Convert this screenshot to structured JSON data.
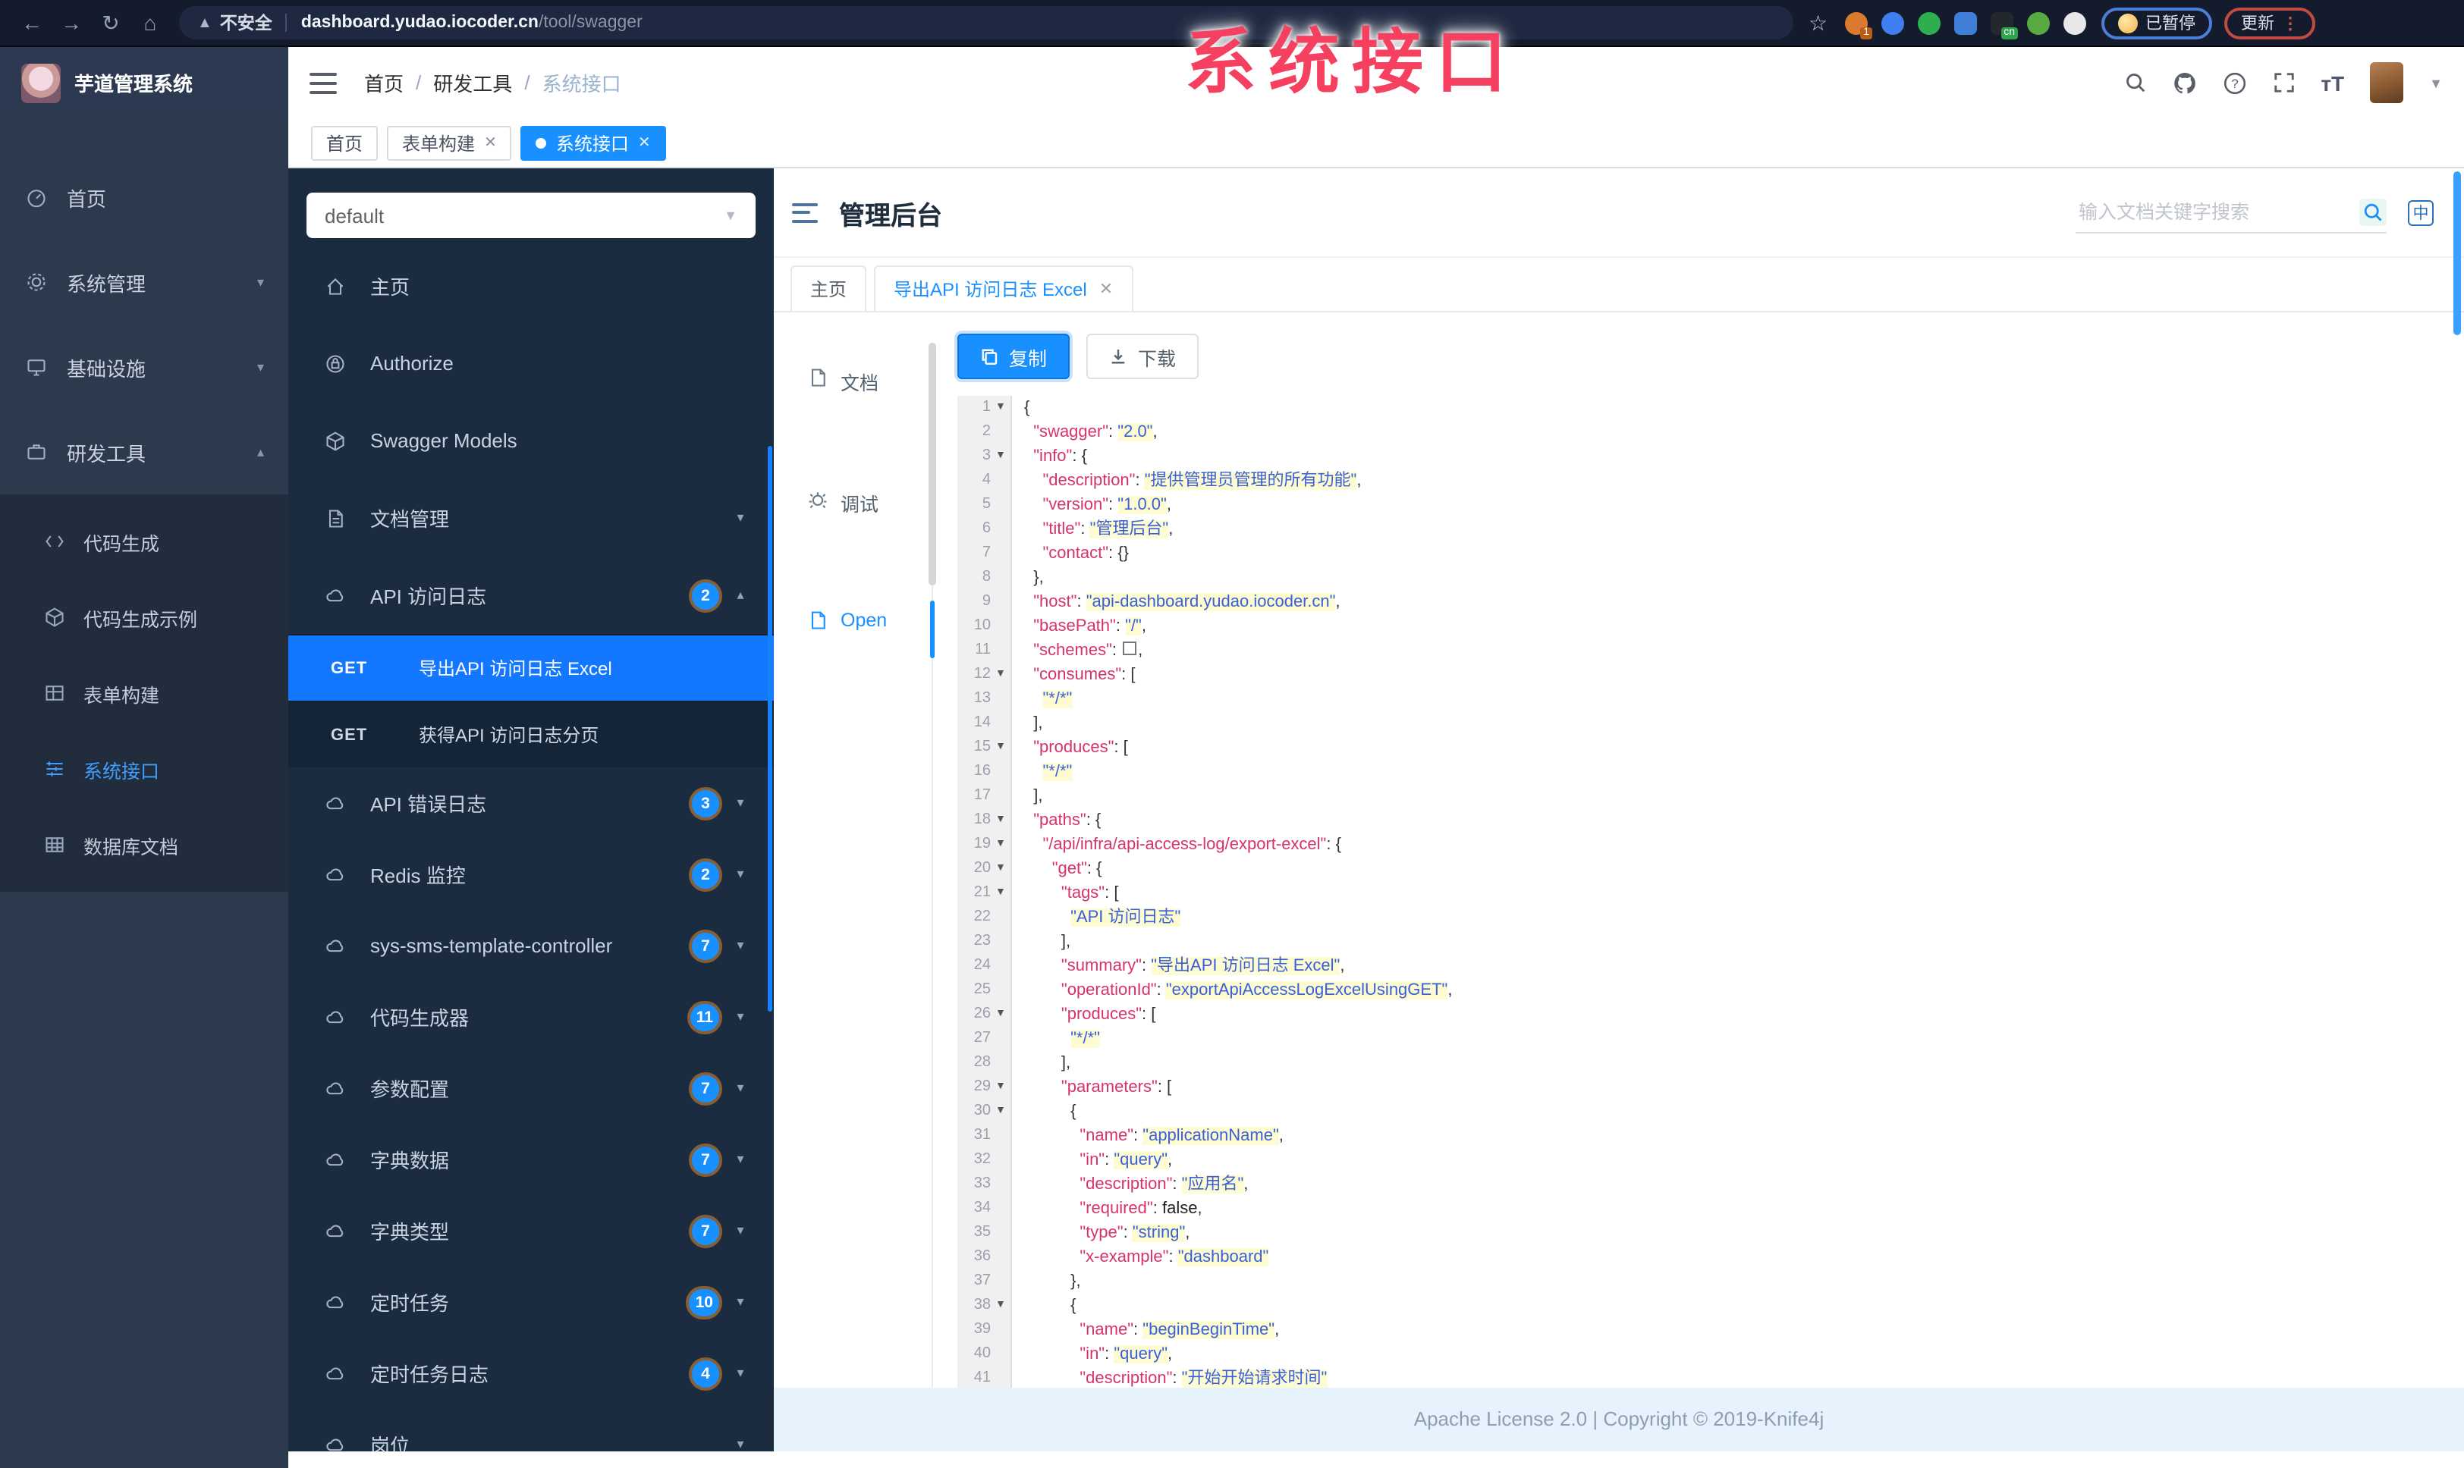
{
  "browser": {
    "security_label": "不安全",
    "url_host": "dashboard.yudao.iocoder.cn",
    "url_path": "/tool/swagger",
    "nav_icons": [
      "back-arrow",
      "forward-arrow",
      "reload",
      "home"
    ],
    "extensions": [
      {
        "name": "bookmark-star",
        "shape": "star"
      },
      {
        "name": "ext-orange",
        "shape": "round",
        "color": "#d97a2e",
        "badge": "1",
        "badge_color": "#b85c1a"
      },
      {
        "name": "ext-blue-drop",
        "shape": "round",
        "color": "#3d7ff0"
      },
      {
        "name": "ext-green-circle",
        "shape": "round",
        "color": "#2fae4e"
      },
      {
        "name": "ext-blue-grid",
        "shape": "square",
        "color": "#3f7fd9"
      },
      {
        "name": "ext-dark-cn",
        "shape": "square",
        "color": "#23282e",
        "badge": "cn",
        "badge_color": "#2da44e"
      },
      {
        "name": "ext-green-leaf",
        "shape": "round",
        "color": "#58a942"
      },
      {
        "name": "ext-white-ghost",
        "shape": "round",
        "color": "#e8e8ea"
      }
    ],
    "paused_label": "已暂停",
    "update_label": "更新",
    "update_menu_glyph": "⋮"
  },
  "overlay": {
    "text": "系统接口",
    "color": "#f5405f"
  },
  "app_header": {
    "logo_text": "芋道管理系统",
    "breadcrumb": [
      "首页",
      "研发工具",
      "系统接口"
    ],
    "right_icons": [
      "search-icon",
      "github-icon",
      "help-icon",
      "fullscreen-icon",
      "font-size-icon",
      "avatar",
      "dropdown-caret"
    ]
  },
  "page_tabs": [
    {
      "label": "首页",
      "closable": false,
      "active": false
    },
    {
      "label": "表单构建",
      "closable": true,
      "active": false
    },
    {
      "label": "系统接口",
      "closable": true,
      "active": true
    }
  ],
  "sidebar": {
    "items": [
      {
        "icon": "dashboard",
        "label": "首页",
        "chevron": ""
      },
      {
        "icon": "gear",
        "label": "系统管理",
        "chevron": "down"
      },
      {
        "icon": "infra",
        "label": "基础设施",
        "chevron": "down"
      },
      {
        "icon": "tools",
        "label": "研发工具",
        "chevron": "up"
      }
    ],
    "subitems": [
      {
        "icon": "code",
        "label": "代码生成",
        "active": false
      },
      {
        "icon": "cube",
        "label": "代码生成示例",
        "active": false
      },
      {
        "icon": "grid",
        "label": "表单构建",
        "active": false
      },
      {
        "icon": "apilist",
        "label": "系统接口",
        "active": true
      },
      {
        "icon": "table",
        "label": "数据库文档",
        "active": false
      }
    ]
  },
  "api_nav": {
    "group_select_value": "default",
    "items": [
      {
        "icon": "home",
        "label": "主页",
        "badge": "",
        "chevron": ""
      },
      {
        "icon": "lock",
        "label": "Authorize",
        "badge": "",
        "chevron": ""
      },
      {
        "icon": "cube",
        "label": "Swagger Models",
        "badge": "",
        "chevron": ""
      },
      {
        "icon": "doc",
        "label": "文档管理",
        "badge": "",
        "chevron": "down"
      },
      {
        "icon": "cloud",
        "label": "API 访问日志",
        "badge": "2",
        "chevron": "up"
      }
    ],
    "endpoints": [
      {
        "method": "GET",
        "label": "导出API 访问日志 Excel",
        "active": true
      },
      {
        "method": "GET",
        "label": "获得API 访问日志分页",
        "active": false
      }
    ],
    "groups": [
      {
        "icon": "cloud",
        "label": "API 错误日志",
        "badge": "3"
      },
      {
        "icon": "cloud",
        "label": "Redis 监控",
        "badge": "2"
      },
      {
        "icon": "cloud",
        "label": "sys-sms-template-controller",
        "badge": "7"
      },
      {
        "icon": "cloud",
        "label": "代码生成器",
        "badge": "11"
      },
      {
        "icon": "cloud",
        "label": "参数配置",
        "badge": "7"
      },
      {
        "icon": "cloud",
        "label": "字典数据",
        "badge": "7"
      },
      {
        "icon": "cloud",
        "label": "字典类型",
        "badge": "7"
      },
      {
        "icon": "cloud",
        "label": "定时任务",
        "badge": "10"
      },
      {
        "icon": "cloud",
        "label": "定时任务日志",
        "badge": "4"
      },
      {
        "icon": "cloud",
        "label": "岗位",
        "badge": ""
      }
    ]
  },
  "content": {
    "title": "管理后台",
    "search_placeholder": "输入文档关键字搜索",
    "lang_glyph": "中",
    "doc_tabs": [
      {
        "label": "主页",
        "closable": false,
        "active": false
      },
      {
        "label": "导出API 访问日志 Excel",
        "closable": true,
        "active": true
      }
    ],
    "rail": [
      {
        "icon": "file",
        "label": "文档",
        "active": false
      },
      {
        "icon": "debug",
        "label": "调试",
        "active": false
      },
      {
        "icon": "file",
        "label": "Open",
        "active": true
      }
    ],
    "copy_label": "复制",
    "download_label": "下载",
    "footer": "Apache License 2.0 | Copyright © 2019-Knife4j"
  },
  "code": {
    "lines": [
      [
        1,
        [
          [
            "p",
            "{"
          ]
        ]
      ],
      [
        0,
        [
          [
            "p",
            "  "
          ],
          [
            "k",
            "\"swagger\""
          ],
          [
            "p",
            ": "
          ],
          [
            "s",
            "\"2.0\""
          ],
          [
            "p",
            ","
          ]
        ]
      ],
      [
        1,
        [
          [
            "p",
            "  "
          ],
          [
            "k",
            "\"info\""
          ],
          [
            "p",
            ": {"
          ]
        ]
      ],
      [
        0,
        [
          [
            "p",
            "    "
          ],
          [
            "k",
            "\"description\""
          ],
          [
            "p",
            ": "
          ],
          [
            "s",
            "\"提供管理员管理的所有功能\""
          ],
          [
            "p",
            ","
          ]
        ]
      ],
      [
        0,
        [
          [
            "p",
            "    "
          ],
          [
            "k",
            "\"version\""
          ],
          [
            "p",
            ": "
          ],
          [
            "s",
            "\"1.0.0\""
          ],
          [
            "p",
            ","
          ]
        ]
      ],
      [
        0,
        [
          [
            "p",
            "    "
          ],
          [
            "k",
            "\"title\""
          ],
          [
            "p",
            ": "
          ],
          [
            "s",
            "\"管理后台\""
          ],
          [
            "p",
            ","
          ]
        ]
      ],
      [
        0,
        [
          [
            "p",
            "    "
          ],
          [
            "k",
            "\"contact\""
          ],
          [
            "p",
            ": {}"
          ]
        ]
      ],
      [
        0,
        [
          [
            "p",
            "  },"
          ]
        ]
      ],
      [
        0,
        [
          [
            "p",
            "  "
          ],
          [
            "k",
            "\"host\""
          ],
          [
            "p",
            ": "
          ],
          [
            "s",
            "\"api-dashboard.yudao.iocoder.cn\""
          ],
          [
            "p",
            ","
          ]
        ]
      ],
      [
        0,
        [
          [
            "p",
            "  "
          ],
          [
            "k",
            "\"basePath\""
          ],
          [
            "p",
            ": "
          ],
          [
            "s",
            "\"/\""
          ],
          [
            "p",
            ","
          ]
        ]
      ],
      [
        0,
        [
          [
            "p",
            "  "
          ],
          [
            "k",
            "\"schemes\""
          ],
          [
            "p",
            ": "
          ],
          [
            "x",
            ""
          ],
          [
            "p",
            ","
          ]
        ]
      ],
      [
        1,
        [
          [
            "p",
            "  "
          ],
          [
            "k",
            "\"consumes\""
          ],
          [
            "p",
            ": ["
          ]
        ]
      ],
      [
        0,
        [
          [
            "p",
            "    "
          ],
          [
            "s",
            "\"*/*\""
          ]
        ]
      ],
      [
        0,
        [
          [
            "p",
            "  ],"
          ]
        ]
      ],
      [
        1,
        [
          [
            "p",
            "  "
          ],
          [
            "k",
            "\"produces\""
          ],
          [
            "p",
            ": ["
          ]
        ]
      ],
      [
        0,
        [
          [
            "p",
            "    "
          ],
          [
            "s",
            "\"*/*\""
          ]
        ]
      ],
      [
        0,
        [
          [
            "p",
            "  ],"
          ]
        ]
      ],
      [
        1,
        [
          [
            "p",
            "  "
          ],
          [
            "k",
            "\"paths\""
          ],
          [
            "p",
            ": {"
          ]
        ]
      ],
      [
        1,
        [
          [
            "p",
            "    "
          ],
          [
            "k",
            "\"/api/infra/api-access-log/export-excel\""
          ],
          [
            "p",
            ": {"
          ]
        ]
      ],
      [
        1,
        [
          [
            "p",
            "      "
          ],
          [
            "k",
            "\"get\""
          ],
          [
            "p",
            ": {"
          ]
        ]
      ],
      [
        1,
        [
          [
            "p",
            "        "
          ],
          [
            "k",
            "\"tags\""
          ],
          [
            "p",
            ": ["
          ]
        ]
      ],
      [
        0,
        [
          [
            "p",
            "          "
          ],
          [
            "s",
            "\"API 访问日志\""
          ]
        ]
      ],
      [
        0,
        [
          [
            "p",
            "        ],"
          ]
        ]
      ],
      [
        0,
        [
          [
            "p",
            "        "
          ],
          [
            "k",
            "\"summary\""
          ],
          [
            "p",
            ": "
          ],
          [
            "s",
            "\"导出API 访问日志 Excel\""
          ],
          [
            "p",
            ","
          ]
        ]
      ],
      [
        0,
        [
          [
            "p",
            "        "
          ],
          [
            "k",
            "\"operationId\""
          ],
          [
            "p",
            ": "
          ],
          [
            "s",
            "\"exportApiAccessLogExcelUsingGET\""
          ],
          [
            "p",
            ","
          ]
        ]
      ],
      [
        1,
        [
          [
            "p",
            "        "
          ],
          [
            "k",
            "\"produces\""
          ],
          [
            "p",
            ": ["
          ]
        ]
      ],
      [
        0,
        [
          [
            "p",
            "          "
          ],
          [
            "s",
            "\"*/*\""
          ]
        ]
      ],
      [
        0,
        [
          [
            "p",
            "        ],"
          ]
        ]
      ],
      [
        1,
        [
          [
            "p",
            "        "
          ],
          [
            "k",
            "\"parameters\""
          ],
          [
            "p",
            ": ["
          ]
        ]
      ],
      [
        1,
        [
          [
            "p",
            "          {"
          ]
        ]
      ],
      [
        0,
        [
          [
            "p",
            "            "
          ],
          [
            "k",
            "\"name\""
          ],
          [
            "p",
            ": "
          ],
          [
            "s",
            "\"applicationName\""
          ],
          [
            "p",
            ","
          ]
        ]
      ],
      [
        0,
        [
          [
            "p",
            "            "
          ],
          [
            "k",
            "\"in\""
          ],
          [
            "p",
            ": "
          ],
          [
            "s",
            "\"query\""
          ],
          [
            "p",
            ","
          ]
        ]
      ],
      [
        0,
        [
          [
            "p",
            "            "
          ],
          [
            "k",
            "\"description\""
          ],
          [
            "p",
            ": "
          ],
          [
            "s",
            "\"应用名\""
          ],
          [
            "p",
            ","
          ]
        ]
      ],
      [
        0,
        [
          [
            "p",
            "            "
          ],
          [
            "k",
            "\"required\""
          ],
          [
            "p",
            ": "
          ],
          [
            "l",
            "false"
          ],
          [
            "p",
            ","
          ]
        ]
      ],
      [
        0,
        [
          [
            "p",
            "            "
          ],
          [
            "k",
            "\"type\""
          ],
          [
            "p",
            ": "
          ],
          [
            "s",
            "\"string\""
          ],
          [
            "p",
            ","
          ]
        ]
      ],
      [
        0,
        [
          [
            "p",
            "            "
          ],
          [
            "k",
            "\"x-example\""
          ],
          [
            "p",
            ": "
          ],
          [
            "s",
            "\"dashboard\""
          ]
        ]
      ],
      [
        0,
        [
          [
            "p",
            "          },"
          ]
        ]
      ],
      [
        1,
        [
          [
            "p",
            "          {"
          ]
        ]
      ],
      [
        0,
        [
          [
            "p",
            "            "
          ],
          [
            "k",
            "\"name\""
          ],
          [
            "p",
            ": "
          ],
          [
            "s",
            "\"beginBeginTime\""
          ],
          [
            "p",
            ","
          ]
        ]
      ],
      [
        0,
        [
          [
            "p",
            "            "
          ],
          [
            "k",
            "\"in\""
          ],
          [
            "p",
            ": "
          ],
          [
            "s",
            "\"query\""
          ],
          [
            "p",
            ","
          ]
        ]
      ],
      [
        0,
        [
          [
            "p",
            "            "
          ],
          [
            "k",
            "\"description\""
          ],
          [
            "p",
            ": "
          ],
          [
            "s",
            "\"开始开始请求时间\""
          ]
        ]
      ]
    ]
  }
}
